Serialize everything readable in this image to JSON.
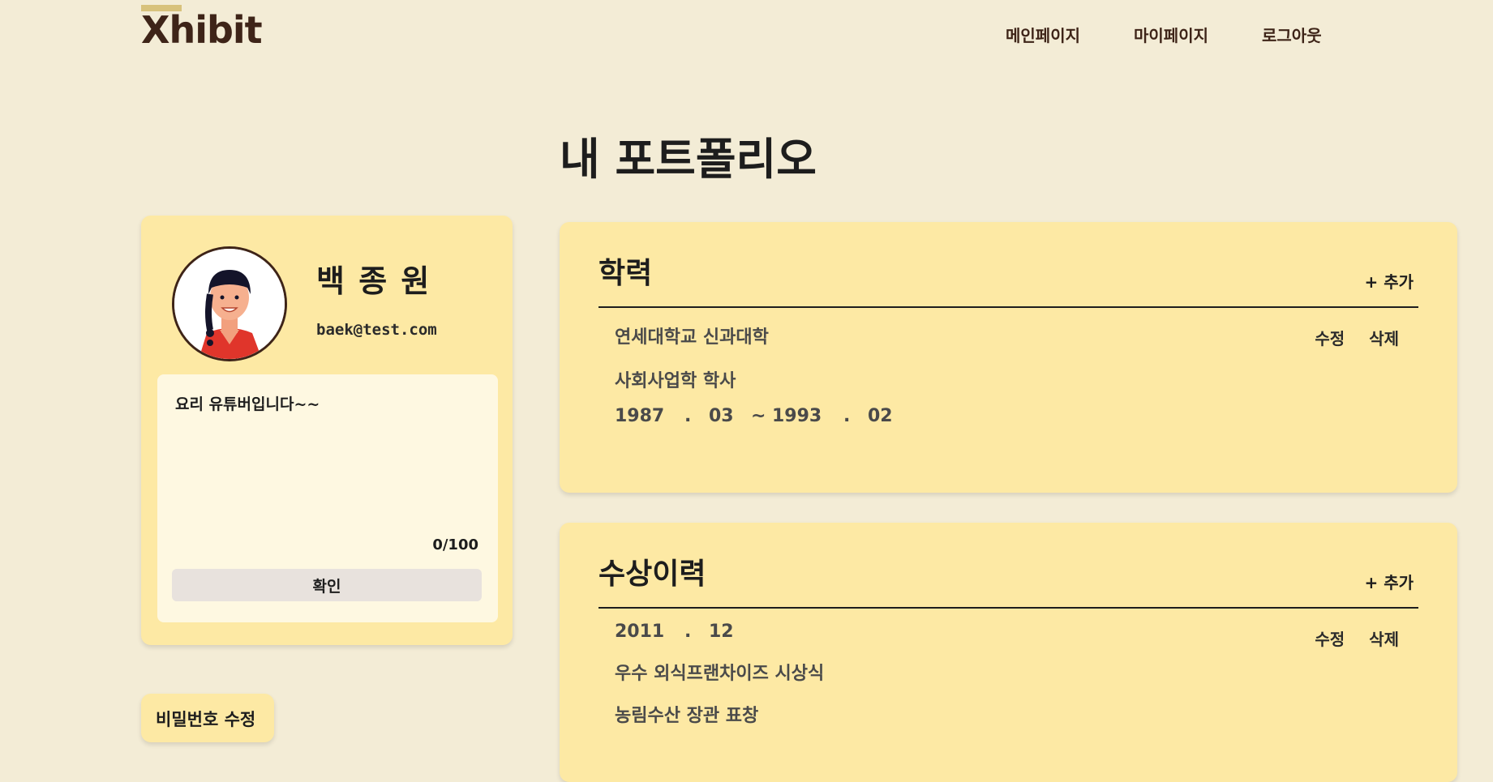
{
  "header": {
    "logo": "Xhibit",
    "nav": [
      "메인페이지",
      "마이페이지",
      "로그아웃"
    ]
  },
  "page_title": "내 포트폴리오",
  "profile": {
    "name": "백 종 원",
    "email": "baek@test.com",
    "bio": "요리 유튜버입니다~~",
    "bio_count": "0/100",
    "confirm_label": "확인",
    "password_label": "비밀번호 수정"
  },
  "education": {
    "title": "학력",
    "add_label": "+ 추가",
    "edit_label": "수정",
    "delete_label": "삭제",
    "school": "연세대학교 신과대학",
    "major": "사회사업학 학사",
    "start_year": "1987",
    "start_month": "03",
    "end_year": "1993",
    "end_month": "02",
    "dot": ".",
    "tilde": "~"
  },
  "awards": {
    "title": "수상이력",
    "add_label": "+ 추가",
    "edit_label": "수정",
    "delete_label": "삭제",
    "year": "2011",
    "month": "12",
    "dot": ".",
    "award_name": "우수 외식프랜차이즈 시상식",
    "award_desc": "농림수산 장관 표창"
  },
  "colors": {
    "background": "#f3ecd6",
    "card": "#fde9a4",
    "bio_box": "#fef8e1",
    "brand": "#3e2418",
    "accent_bar": "#d8c27c",
    "button": "#e8e2dd"
  }
}
